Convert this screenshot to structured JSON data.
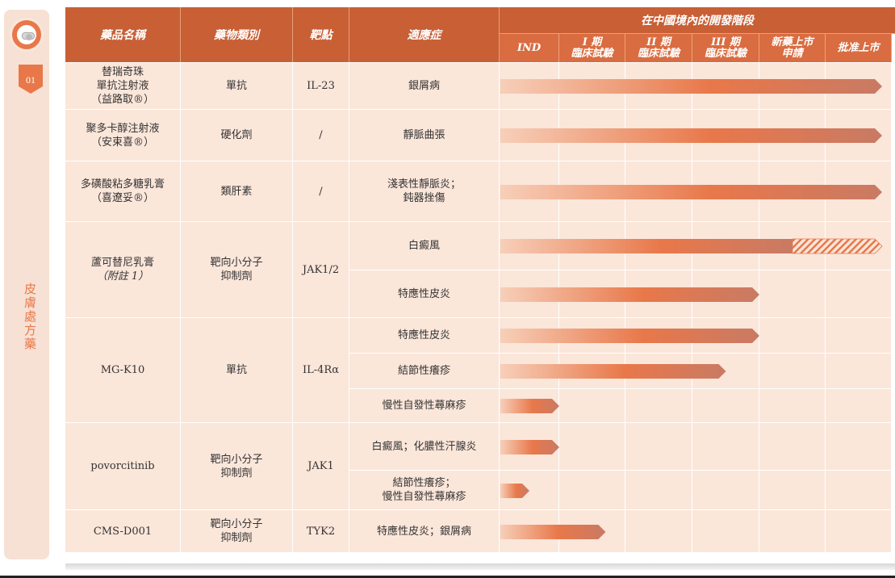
{
  "sidebar": {
    "section_number": "01",
    "section_label": "皮膚處方藥",
    "logo_icon": "capsule-icon",
    "accent": "#e8784a"
  },
  "header": {
    "drug_name": "藥品名稱",
    "drug_class": "藥物類別",
    "target": "靶點",
    "indication": "適應症",
    "phase_group": "在中國境內的開發階段",
    "phases": [
      "IND",
      "I 期\n臨床試驗",
      "II 期\n臨床試驗",
      "III 期\n臨床試驗",
      "新藥上市\n申請",
      "批准上市"
    ]
  },
  "colors": {
    "header": "#c85f35",
    "header_phase": "#d96c40",
    "cell_bg": "#fbe6da",
    "bar_start": "#f7cfb9",
    "bar_mid": "#e8784a",
    "bar_end": "#c97a64"
  },
  "drugs": [
    {
      "name": "替瑞奇珠\n單抗注射液\n（益路取®）",
      "class": "單抗",
      "target": "IL-23",
      "indications": [
        {
          "label": "銀屑病",
          "progress": 6.0,
          "pending_end": null
        }
      ]
    },
    {
      "name": "聚多卡醇注射液\n（安束喜®）",
      "class": "硬化劑",
      "target": "/",
      "indications": [
        {
          "label": "靜脈曲張",
          "progress": 6.0,
          "pending_end": null
        }
      ]
    },
    {
      "name": "多磺酸粘多糖乳膏\n（喜遼妥®）",
      "class": "類肝素",
      "target": "/",
      "indications": [
        {
          "label": "淺表性靜脈炎；\n鈍器挫傷",
          "progress": 6.0,
          "pending_end": null
        }
      ]
    },
    {
      "name": "蘆可替尼乳膏",
      "note": "（附註 1）",
      "class": "靶向小分子\n抑制劑",
      "target": "JAK1/2",
      "indications": [
        {
          "label": "白癜風",
          "progress": 4.5,
          "pending_end": 6.0
        },
        {
          "label": "特應性皮炎",
          "progress": 4.0,
          "pending_end": null
        }
      ]
    },
    {
      "name": "MG-K10",
      "class": "單抗",
      "target": "IL-4Rα",
      "indications": [
        {
          "label": "特應性皮炎",
          "progress": 4.0,
          "pending_end": null
        },
        {
          "label": "結節性癢疹",
          "progress": 3.5,
          "pending_end": null
        },
        {
          "label": "慢性自發性蕁麻疹",
          "progress": 1.0,
          "pending_end": null
        }
      ]
    },
    {
      "name": "povorcitinib",
      "class": "靶向小分子\n抑制劑",
      "target": "JAK1",
      "indications": [
        {
          "label": "白癜風；化膿性汗腺炎",
          "progress": 1.0,
          "pending_end": null
        },
        {
          "label": "結節性癢疹；\n慢性自發性蕁麻疹",
          "progress": 0.5,
          "pending_end": null
        }
      ]
    },
    {
      "name": "CMS-D001",
      "class": "靶向小分子\n抑制劑",
      "target": "TYK2",
      "indications": [
        {
          "label": "特應性皮炎；銀屑病",
          "progress": 1.7,
          "pending_end": null
        }
      ]
    }
  ]
}
